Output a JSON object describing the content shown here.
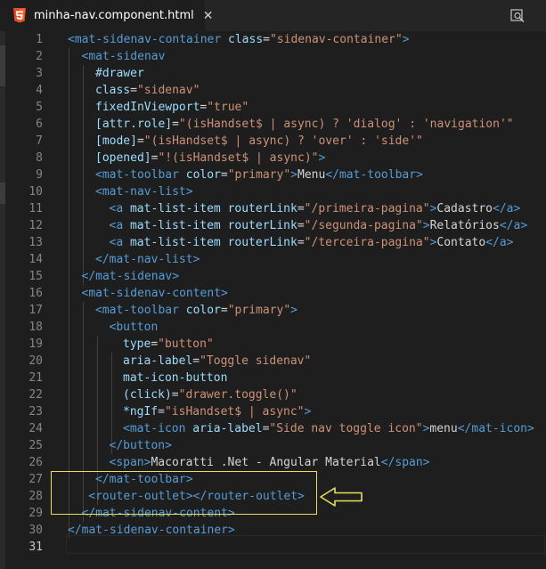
{
  "tab": {
    "title": "minha-nav.component.html",
    "file_icon": "html5-icon",
    "close_label": "✕"
  },
  "toolbar": {
    "split_icon": "open-preview-icon"
  },
  "lines": [
    {
      "n": "1",
      "i": 0,
      "t": [
        [
          "tag",
          "<mat-sidenav-container "
        ],
        [
          "attr",
          "class"
        ],
        [
          "text",
          "="
        ],
        [
          "str",
          "\"sidenav-container\""
        ],
        [
          "tag",
          ">"
        ]
      ]
    },
    {
      "n": "2",
      "i": 2,
      "t": [
        [
          "tag",
          "<mat-sidenav"
        ]
      ]
    },
    {
      "n": "3",
      "i": 4,
      "t": [
        [
          "attr",
          "#drawer"
        ]
      ]
    },
    {
      "n": "4",
      "i": 4,
      "t": [
        [
          "attr",
          "class"
        ],
        [
          "text",
          "="
        ],
        [
          "str",
          "\"sidenav\""
        ]
      ]
    },
    {
      "n": "5",
      "i": 4,
      "t": [
        [
          "attr",
          "fixedInViewport"
        ],
        [
          "text",
          "="
        ],
        [
          "str",
          "\"true\""
        ]
      ]
    },
    {
      "n": "6",
      "i": 4,
      "t": [
        [
          "attr",
          "[attr.role]"
        ],
        [
          "text",
          "="
        ],
        [
          "str",
          "\"(isHandset$ | async) ? 'dialog' : 'navigation'\""
        ]
      ]
    },
    {
      "n": "7",
      "i": 4,
      "t": [
        [
          "attr",
          "[mode]"
        ],
        [
          "text",
          "="
        ],
        [
          "str",
          "\"(isHandset$ | async) ? 'over' : 'side'\""
        ]
      ]
    },
    {
      "n": "8",
      "i": 4,
      "t": [
        [
          "attr",
          "[opened]"
        ],
        [
          "text",
          "="
        ],
        [
          "str",
          "\"!(isHandset$ | async)\""
        ],
        [
          "tag",
          ">"
        ]
      ]
    },
    {
      "n": "9",
      "i": 4,
      "t": [
        [
          "tag",
          "<mat-toolbar "
        ],
        [
          "attr",
          "color"
        ],
        [
          "text",
          "="
        ],
        [
          "str",
          "\"primary\""
        ],
        [
          "tag",
          ">"
        ],
        [
          "text",
          "Menu"
        ],
        [
          "tag",
          "</mat-toolbar>"
        ]
      ]
    },
    {
      "n": "10",
      "i": 4,
      "t": [
        [
          "tag",
          "<mat-nav-list>"
        ]
      ]
    },
    {
      "n": "11",
      "i": 6,
      "t": [
        [
          "tag",
          "<a "
        ],
        [
          "attr",
          "mat-list-item "
        ],
        [
          "attr",
          "routerLink"
        ],
        [
          "text",
          "="
        ],
        [
          "str",
          "\"/primeira-pagina\""
        ],
        [
          "tag",
          ">"
        ],
        [
          "text",
          "Cadastro"
        ],
        [
          "tag",
          "</a>"
        ]
      ]
    },
    {
      "n": "12",
      "i": 6,
      "t": [
        [
          "tag",
          "<a "
        ],
        [
          "attr",
          "mat-list-item "
        ],
        [
          "attr",
          "routerLink"
        ],
        [
          "text",
          "="
        ],
        [
          "str",
          "\"/segunda-pagina\""
        ],
        [
          "tag",
          ">"
        ],
        [
          "text",
          "Relatórios"
        ],
        [
          "tag",
          "</a>"
        ]
      ]
    },
    {
      "n": "13",
      "i": 6,
      "t": [
        [
          "tag",
          "<a "
        ],
        [
          "attr",
          "mat-list-item "
        ],
        [
          "attr",
          "routerLink"
        ],
        [
          "text",
          "="
        ],
        [
          "str",
          "\"/terceira-pagina\""
        ],
        [
          "tag",
          ">"
        ],
        [
          "text",
          "Contato"
        ],
        [
          "tag",
          "</a>"
        ]
      ]
    },
    {
      "n": "14",
      "i": 4,
      "t": [
        [
          "tag",
          "</mat-nav-list>"
        ]
      ]
    },
    {
      "n": "15",
      "i": 2,
      "t": [
        [
          "tag",
          "</mat-sidenav>"
        ]
      ]
    },
    {
      "n": "16",
      "i": 2,
      "t": [
        [
          "tag",
          "<mat-sidenav-content>"
        ]
      ]
    },
    {
      "n": "17",
      "i": 4,
      "t": [
        [
          "tag",
          "<mat-toolbar "
        ],
        [
          "attr",
          "color"
        ],
        [
          "text",
          "="
        ],
        [
          "str",
          "\"primary\""
        ],
        [
          "tag",
          ">"
        ]
      ]
    },
    {
      "n": "18",
      "i": 6,
      "t": [
        [
          "tag",
          "<button"
        ]
      ]
    },
    {
      "n": "19",
      "i": 8,
      "t": [
        [
          "attr",
          "type"
        ],
        [
          "text",
          "="
        ],
        [
          "str",
          "\"button\""
        ]
      ]
    },
    {
      "n": "20",
      "i": 8,
      "t": [
        [
          "attr",
          "aria-label"
        ],
        [
          "text",
          "="
        ],
        [
          "str",
          "\"Toggle sidenav\""
        ]
      ]
    },
    {
      "n": "21",
      "i": 8,
      "t": [
        [
          "attr",
          "mat-icon-button"
        ]
      ]
    },
    {
      "n": "22",
      "i": 8,
      "t": [
        [
          "attr",
          "(click)"
        ],
        [
          "text",
          "="
        ],
        [
          "str",
          "\"drawer.toggle()\""
        ]
      ]
    },
    {
      "n": "23",
      "i": 8,
      "t": [
        [
          "attr",
          "*ngIf"
        ],
        [
          "text",
          "="
        ],
        [
          "str",
          "\"isHandset$ | async\""
        ],
        [
          "tag",
          ">"
        ]
      ]
    },
    {
      "n": "24",
      "i": 8,
      "t": [
        [
          "tag",
          "<mat-icon "
        ],
        [
          "attr",
          "aria-label"
        ],
        [
          "text",
          "="
        ],
        [
          "str",
          "\"Side nav toggle icon\""
        ],
        [
          "tag",
          ">"
        ],
        [
          "text",
          "menu"
        ],
        [
          "tag",
          "</mat-icon>"
        ]
      ]
    },
    {
      "n": "25",
      "i": 6,
      "t": [
        [
          "tag",
          "</button>"
        ]
      ]
    },
    {
      "n": "26",
      "i": 6,
      "t": [
        [
          "tag",
          "<span>"
        ],
        [
          "text",
          "Macoratti .Net - Angular Material"
        ],
        [
          "tag",
          "</span>"
        ]
      ]
    },
    {
      "n": "27",
      "i": 4,
      "t": [
        [
          "tag",
          "</mat-toolbar>"
        ]
      ]
    },
    {
      "n": "28",
      "i": 3,
      "t": [
        [
          "tag",
          "<router-outlet></router-outlet>"
        ]
      ]
    },
    {
      "n": "29",
      "i": 2,
      "t": [
        [
          "tag",
          "</mat-sidenav-content>"
        ]
      ]
    },
    {
      "n": "30",
      "i": 0,
      "t": [
        [
          "tag",
          "</mat-sidenav-container>"
        ]
      ]
    },
    {
      "n": "31",
      "i": 0,
      "t": []
    }
  ],
  "colors": {
    "tag": "#569cd6",
    "attr": "#9cdcfe",
    "string": "#ce9178",
    "text": "#d4d4d4",
    "background": "#1e1e1e",
    "highlight_box": "#e8e05a"
  },
  "annotation": {
    "arrow_icon": "left-arrow-annotation-icon"
  }
}
